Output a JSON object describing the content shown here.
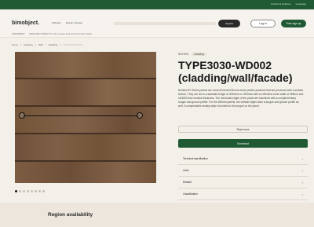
{
  "topbar": {
    "links": [
      "Contact & locations",
      "Language"
    ]
  },
  "header": {
    "logo": "bimobject.",
    "nav": [
      "Software",
      "Design software"
    ],
    "search_button": "Search",
    "login": "Log in",
    "signup": "Free sign up"
  },
  "subline": {
    "tag": "LOGOTEXT",
    "text": "FREE BIM OBJECTS with content and technical information"
  },
  "breadcrumb": [
    "Home",
    "Category",
    "Wall",
    "Cladding",
    "TYPE3030-WD002"
  ],
  "product": {
    "brand": "NICHIHA",
    "chip": "Cladding",
    "title": "TYPE3030-WD002 (cladding/wall/facade)",
    "description": "Nichiha EX Series panels are cement bonded fibrous wood particle products that are produced with a surface texture. They are cut to a standard length of 3030mm or 1820mm with an effective cover width of 455mm and 16/18/21mm nominal thickness. The horizontal edges of the panel are machined with a complementary tongue and groove profile. For the 455mm panels, the vertical edges have a tongue and groove profile as well. A compressible sealing strip is bonded to the tongue on the panel.",
    "read_more": "Read more",
    "download": "Download"
  },
  "accordion": [
    "Technical specification",
    "Links",
    "Related",
    "Classification"
  ],
  "gallery": {
    "slides": 8,
    "active_index": 0
  },
  "region": {
    "title": "Region availability"
  },
  "colors": {
    "brand_green": "#1f5a34",
    "background": "#f3efe9",
    "wood": "#7a5a3f"
  }
}
